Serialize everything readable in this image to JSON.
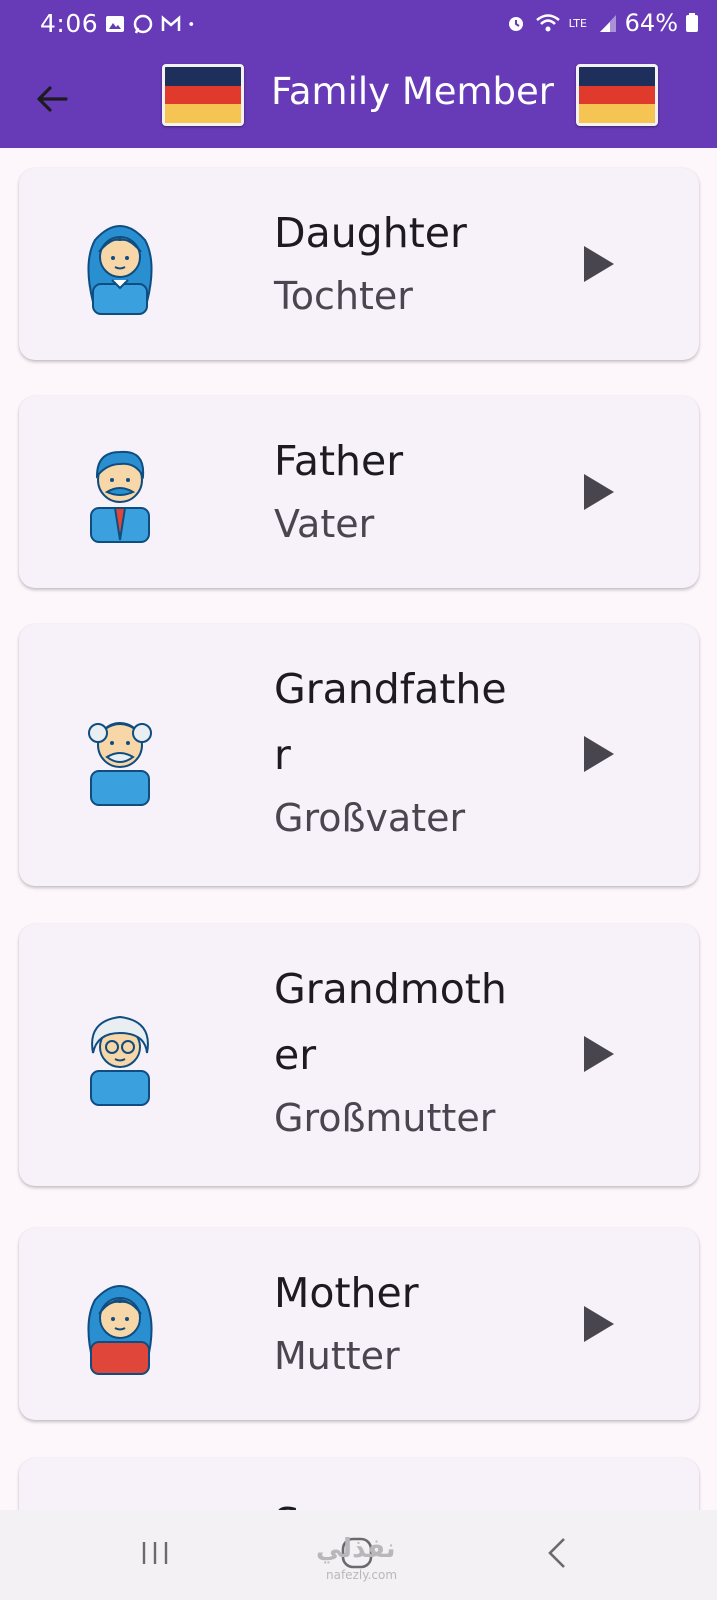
{
  "status_bar": {
    "time": "4:06",
    "battery": "64%",
    "network_label": "LTE"
  },
  "app_bar": {
    "title": "Family Member"
  },
  "cards": [
    {
      "word": "Daughter",
      "translation": "Tochter",
      "avatar": "daughter-avatar-icon"
    },
    {
      "word": "Father",
      "translation": "Vater",
      "avatar": "father-avatar-icon"
    },
    {
      "word": "Grandfather",
      "translation": "Großvater",
      "avatar": "grandfather-avatar-icon"
    },
    {
      "word": "Grandmother",
      "translation": "Großmutter",
      "avatar": "grandmother-avatar-icon"
    },
    {
      "word": "Mother",
      "translation": "Mutter",
      "avatar": "mother-avatar-icon"
    },
    {
      "word": "S",
      "translation": "",
      "avatar": "son-avatar-icon"
    }
  ],
  "watermark": {
    "text": "نفذلي",
    "domain": "nafezly.com"
  },
  "colors": {
    "app_bar": "#673ab7",
    "card_bg": "#f7f2f9",
    "page_bg": "#fdf7fb"
  }
}
